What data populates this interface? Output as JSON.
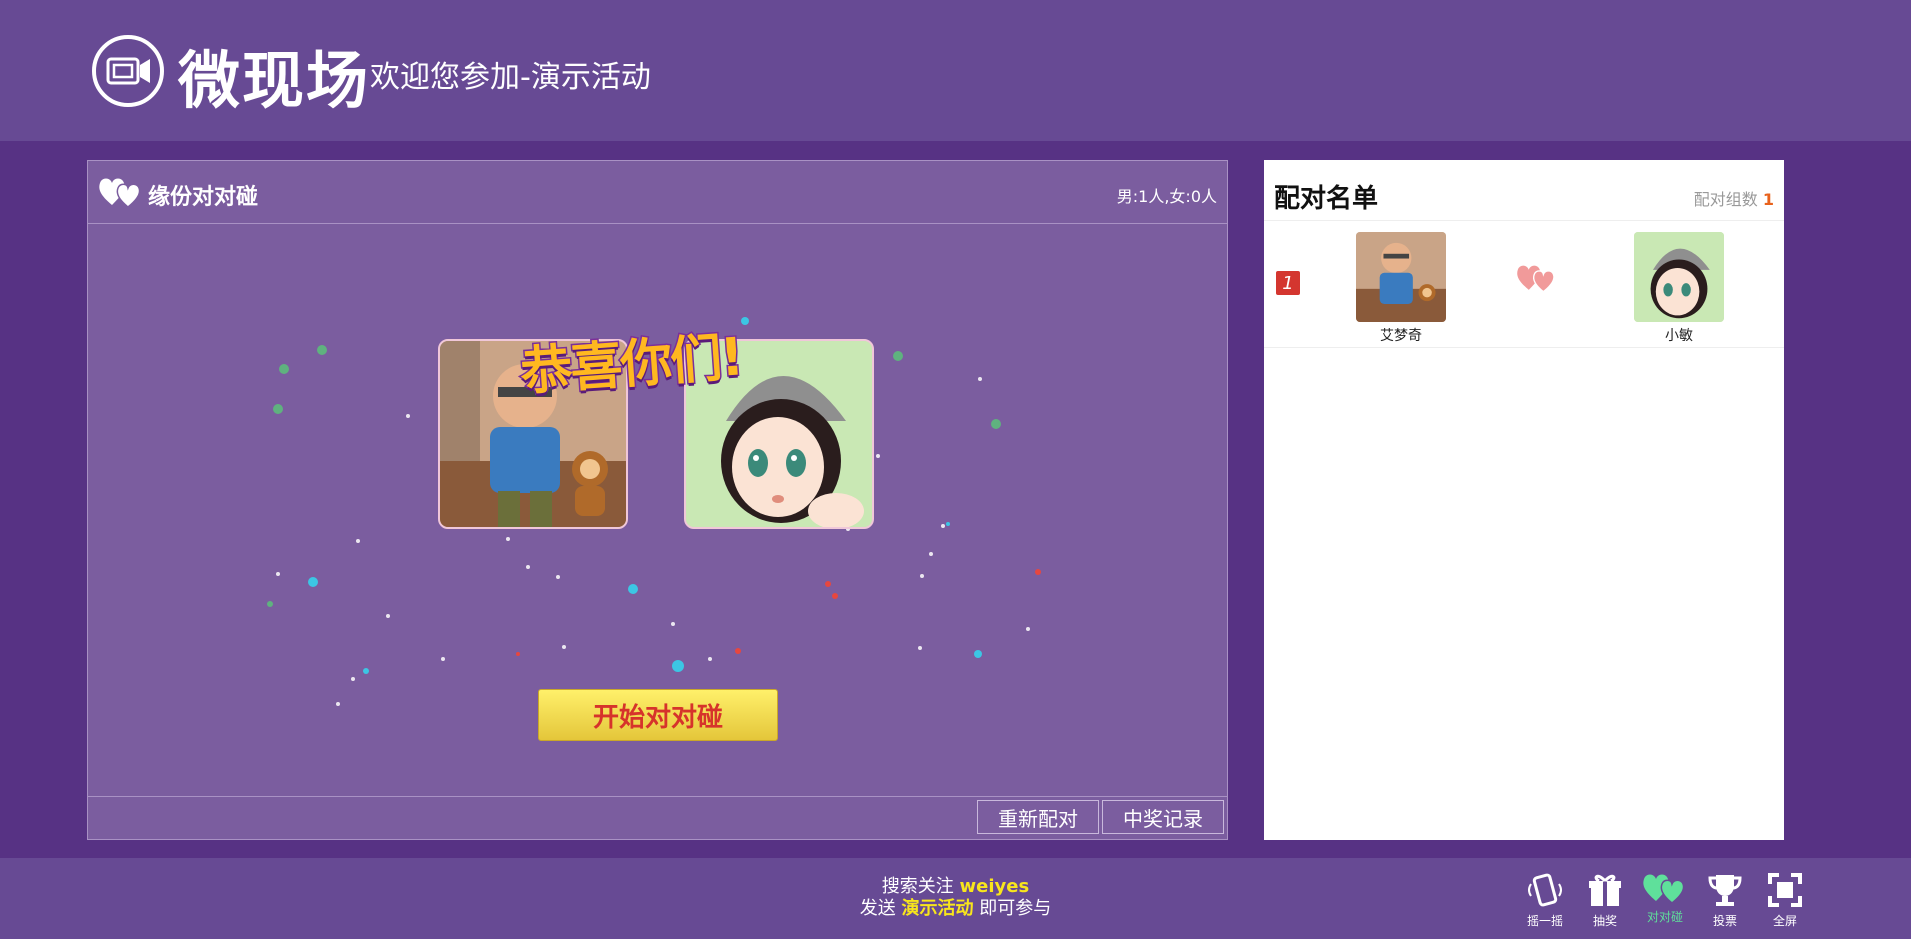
{
  "header": {
    "brand": "微现场",
    "welcome": "欢迎您参加-演示活动"
  },
  "main": {
    "title": "缘份对对碰",
    "gender_count": "男:1人,女:0人",
    "congrats": "恭喜你们!",
    "start_button": "开始对对碰",
    "rematch_button": "重新配对",
    "records_button": "中奖记录"
  },
  "side": {
    "title": "配对名单",
    "count_label": "配对组数",
    "count": "1",
    "pairs": [
      {
        "rank": "1",
        "name_a": "艾梦奇",
        "name_b": "小敏"
      }
    ]
  },
  "footer": {
    "line1_prefix": "搜索关注",
    "line1_highlight": "weiyes",
    "line2_prefix": "发送",
    "line2_highlight": "演示活动",
    "line2_suffix": "即可参与",
    "tools": [
      "摇一摇",
      "抽奖",
      "对对碰",
      "投票",
      "全屏"
    ]
  },
  "colors": {
    "accent": "#674a94",
    "button_yellow": "#f6e04e",
    "active_tool": "#5fe09b"
  },
  "icons": [
    "camera-icon",
    "hearts-icon",
    "shake-icon",
    "gift-icon",
    "trophy-icon",
    "fullscreen-icon"
  ]
}
